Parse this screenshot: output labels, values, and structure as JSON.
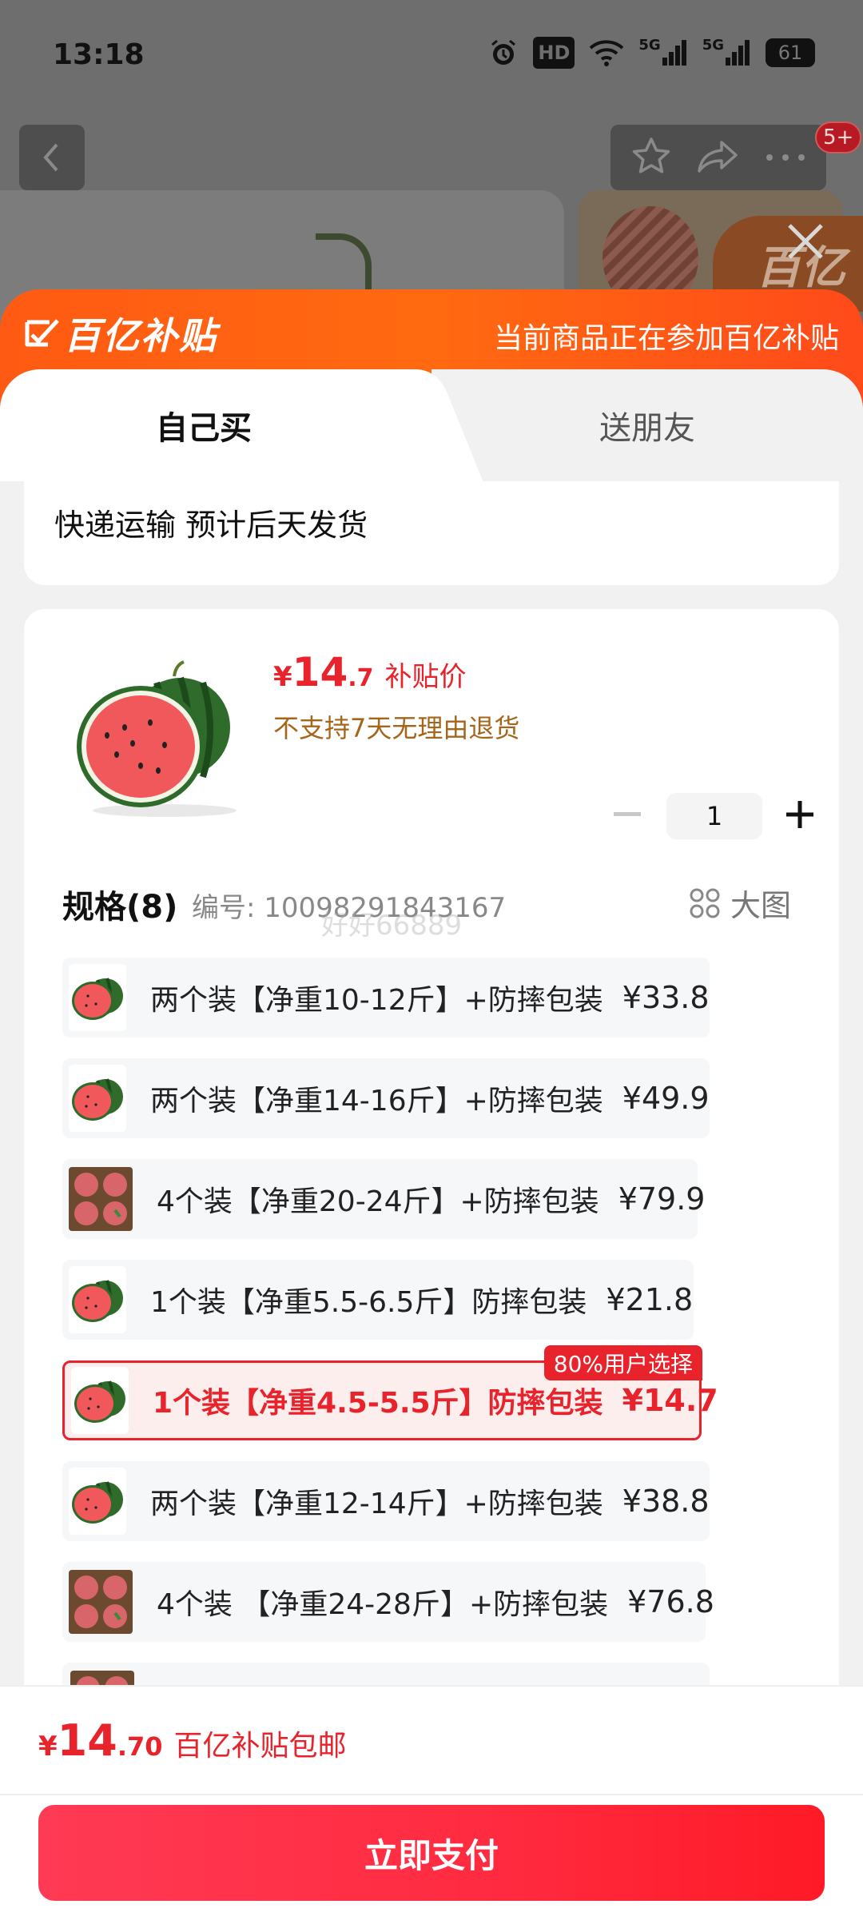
{
  "status_bar": {
    "time": "13:18",
    "hd_label": "HD",
    "net1": "5G",
    "net2": "5G",
    "battery": "61"
  },
  "background": {
    "badge": "5+",
    "logo_text": "百亿"
  },
  "sheet": {
    "brand_text": "百亿补贴",
    "brand_subtitle": "当前商品正在参加百亿补贴",
    "tabs": [
      {
        "label": "自己买",
        "active": true
      },
      {
        "label": "送朋友",
        "active": false
      }
    ],
    "shipping": "快递运输 预计后天发货"
  },
  "product": {
    "price_symbol": "¥",
    "price_int": "14",
    "price_dec": ".7",
    "price_label": "补贴价",
    "return_note": "不支持7天无理由退货",
    "quantity": "1"
  },
  "specs": {
    "title": "规格(8)",
    "code": "编号: 10098291843167",
    "watermark": "好好66889",
    "big_image_label": "大图",
    "items": [
      {
        "label": "两个装【净重10-12斤】+防摔包装",
        "price": "¥33.8",
        "thumb": "watermelon",
        "selected": false
      },
      {
        "label": "两个装【净重14-16斤】+防摔包装",
        "price": "¥49.9",
        "thumb": "watermelon",
        "selected": false
      },
      {
        "label": "4个装【净重20-24斤】+防摔包装",
        "price": "¥79.9",
        "thumb": "box",
        "selected": false
      },
      {
        "label": "1个装【净重5.5-6.5斤】防摔包装",
        "price": "¥21.8",
        "thumb": "watermelon",
        "selected": false
      },
      {
        "label": "1个装【净重4.5-5.5斤】防摔包装",
        "price": "¥14.7",
        "thumb": "watermelon",
        "selected": true,
        "tag": "80%用户选择"
      },
      {
        "label": "两个装【净重12-14斤】+防摔包装",
        "price": "¥38.8",
        "thumb": "watermelon",
        "selected": false
      },
      {
        "label": "4个装 【净重24-28斤】+防摔包装",
        "price": "¥76.8",
        "thumb": "box",
        "selected": false
      },
      {
        "label": "",
        "price": "",
        "thumb": "box",
        "selected": false
      }
    ]
  },
  "footer": {
    "price_symbol": "¥",
    "price_int": "14",
    "price_dec": ".70",
    "note": "百亿补贴包邮",
    "pay_label": "立即支付"
  },
  "colors": {
    "accent_red": "#e8232b",
    "brand_orange": "#ff5a13",
    "note_brown": "#a5661c"
  }
}
